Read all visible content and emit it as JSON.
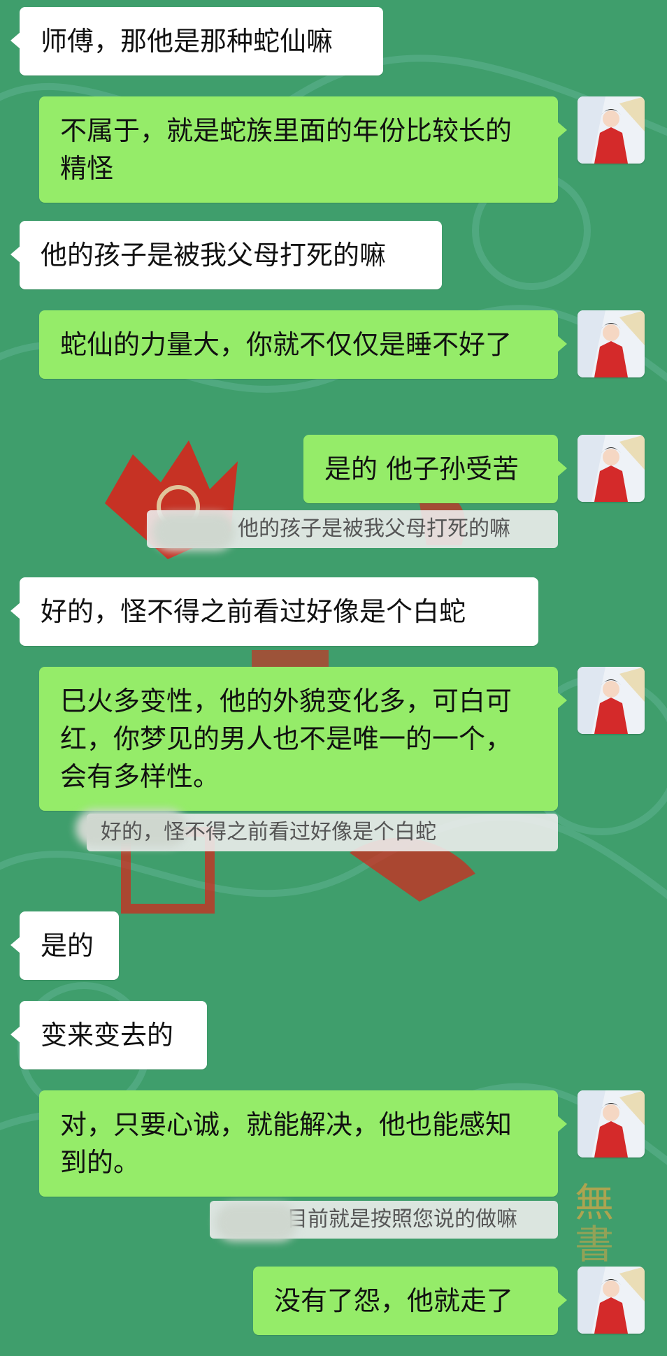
{
  "messages": [
    {
      "side": "in",
      "text": "师傅，那他是那种蛇仙嘛"
    },
    {
      "side": "out",
      "text": "不属于，就是蛇族里面的年份比较长的精怪"
    },
    {
      "side": "in",
      "text": "他的孩子是被我父母打死的嘛"
    },
    {
      "side": "out",
      "text": "蛇仙的力量大，你就不仅仅是睡不好了"
    },
    {
      "side": "out",
      "text": "是的 他子孙受苦"
    },
    {
      "side": "in",
      "text": "好的，怪不得之前看过好像是个白蛇"
    },
    {
      "side": "out",
      "text": "巳火多变性，他的外貌变化多，可白可红，你梦见的男人也不是唯一的一个，会有多样性。"
    },
    {
      "side": "in",
      "text": "是的"
    },
    {
      "side": "in",
      "text": "变来变去的"
    },
    {
      "side": "out",
      "text": "对，只要心诚，就能解决，他也能感知到的。"
    },
    {
      "side": "out",
      "text": "没有了怨，他就走了"
    }
  ],
  "quotes": [
    {
      "text": "他的孩子是被我父母打死的嘛"
    },
    {
      "text": "好的，怪不得之前看过好像是个白蛇"
    },
    {
      "text": "目前就是按照您说的做嘛"
    }
  ],
  "avatar_icon": "red-robed-woman-avatar",
  "colors": {
    "chat_background": "#3f9e6c",
    "incoming_bubble": "#ffffff",
    "outgoing_bubble": "#95ec69",
    "quote_background": "#ececec"
  }
}
